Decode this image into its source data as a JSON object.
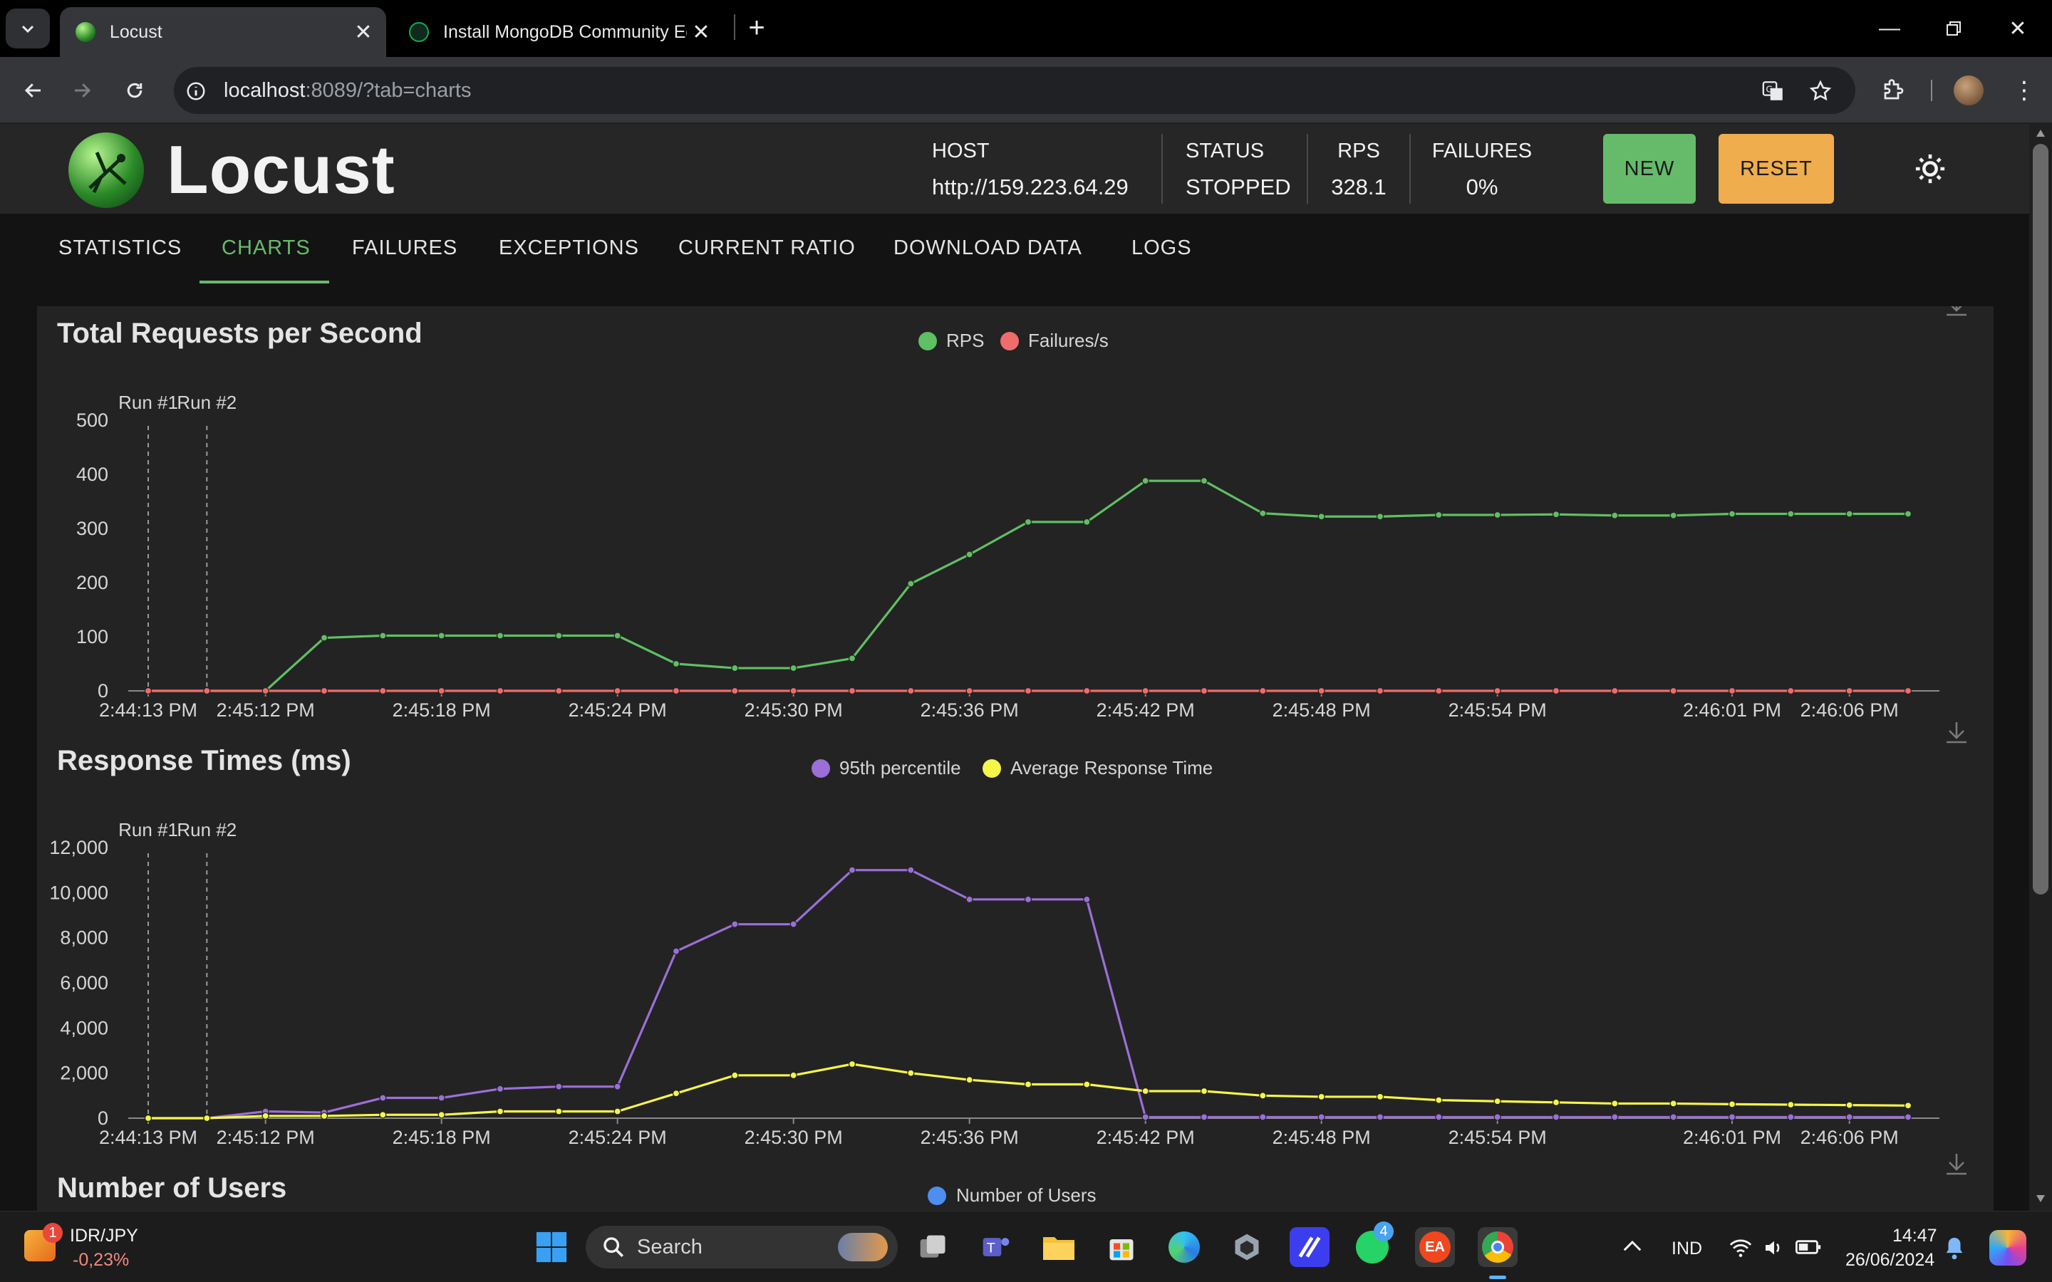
{
  "browser": {
    "tabs": [
      {
        "title": "Locust",
        "active": true
      },
      {
        "title": "Install MongoDB Community Ed",
        "active": false
      }
    ],
    "url_host": "localhost",
    "url_rest": ":8089/?tab=charts",
    "colors": {
      "tabstrip": "#000000",
      "toolbar": "#35363a"
    }
  },
  "app": {
    "brand": "Locust",
    "host_label": "HOST",
    "host_value": "http://159.223.64.29",
    "status_label": "STATUS",
    "status_value": "STOPPED",
    "rps_label": "RPS",
    "rps_value": "328.1",
    "failures_label": "FAILURES",
    "failures_value": "0%",
    "new_label": "NEW",
    "reset_label": "RESET",
    "colors": {
      "new": "#66bb6a",
      "reset": "#f0ad4e",
      "accent": "#66bb6a"
    },
    "tabs": [
      "STATISTICS",
      "CHARTS",
      "FAILURES",
      "EXCEPTIONS",
      "CURRENT RATIO",
      "DOWNLOAD DATA",
      "LOGS"
    ],
    "active_tab": "CHARTS"
  },
  "chart_data": [
    {
      "type": "line",
      "title": "Total Requests per Second",
      "x": [
        "2:44:13 PM",
        "2:45:10 PM",
        "2:45:12 PM",
        "2:45:14 PM",
        "2:45:16 PM",
        "2:45:18 PM",
        "2:45:20 PM",
        "2:45:22 PM",
        "2:45:24 PM",
        "2:45:26 PM",
        "2:45:28 PM",
        "2:45:30 PM",
        "2:45:32 PM",
        "2:45:34 PM",
        "2:45:36 PM",
        "2:45:38 PM",
        "2:45:40 PM",
        "2:45:42 PM",
        "2:45:44 PM",
        "2:45:46 PM",
        "2:45:48 PM",
        "2:45:50 PM",
        "2:45:52 PM",
        "2:45:54 PM",
        "2:45:56 PM",
        "2:45:58 PM",
        "2:46:00 PM",
        "2:46:02 PM",
        "2:46:04 PM",
        "2:46:06 PM",
        "2:46:08 PM"
      ],
      "xticks": [
        "2:44:13 PM",
        "2:45:12 PM",
        "2:45:18 PM",
        "2:45:24 PM",
        "2:45:30 PM",
        "2:45:36 PM",
        "2:45:42 PM",
        "2:45:48 PM",
        "2:45:54 PM",
        "2:46:01 PM",
        "2:46:06 PM"
      ],
      "ylim": [
        0,
        500
      ],
      "yticks": [
        "0",
        "100",
        "200",
        "300",
        "400",
        "500"
      ],
      "run_markers": [
        "Run #1",
        "Run #2"
      ],
      "series": [
        {
          "name": "RPS",
          "color": "#5fbf63",
          "values": [
            0,
            0,
            0,
            98,
            102,
            102,
            102,
            102,
            102,
            50,
            42,
            42,
            60,
            198,
            252,
            312,
            312,
            388,
            388,
            328,
            322,
            322,
            325,
            325,
            326,
            324,
            324,
            327,
            327,
            327,
            327
          ]
        },
        {
          "name": "Failures/s",
          "color": "#ef6c6c",
          "values": [
            0,
            0,
            0,
            0,
            0,
            0,
            0,
            0,
            0,
            0,
            0,
            0,
            0,
            0,
            0,
            0,
            0,
            0,
            0,
            0,
            0,
            0,
            0,
            0,
            0,
            0,
            0,
            0,
            0,
            0,
            0
          ]
        }
      ]
    },
    {
      "type": "line",
      "title": "Response Times (ms)",
      "x": [
        "2:44:13 PM",
        "2:45:10 PM",
        "2:45:12 PM",
        "2:45:14 PM",
        "2:45:16 PM",
        "2:45:18 PM",
        "2:45:20 PM",
        "2:45:22 PM",
        "2:45:24 PM",
        "2:45:26 PM",
        "2:45:28 PM",
        "2:45:30 PM",
        "2:45:32 PM",
        "2:45:34 PM",
        "2:45:36 PM",
        "2:45:38 PM",
        "2:45:40 PM",
        "2:45:42 PM",
        "2:45:44 PM",
        "2:45:46 PM",
        "2:45:48 PM",
        "2:45:50 PM",
        "2:45:52 PM",
        "2:45:54 PM",
        "2:45:56 PM",
        "2:45:58 PM",
        "2:46:00 PM",
        "2:46:02 PM",
        "2:46:04 PM",
        "2:46:06 PM",
        "2:46:08 PM"
      ],
      "xticks": [
        "2:44:13 PM",
        "2:45:12 PM",
        "2:45:18 PM",
        "2:45:24 PM",
        "2:45:30 PM",
        "2:45:36 PM",
        "2:45:42 PM",
        "2:45:48 PM",
        "2:45:54 PM",
        "2:46:01 PM",
        "2:46:06 PM"
      ],
      "ylim": [
        0,
        12000
      ],
      "yticks": [
        "0",
        "2,000",
        "4,000",
        "6,000",
        "8,000",
        "10,000",
        "12,000"
      ],
      "run_markers": [
        "Run #1",
        "Run #2"
      ],
      "series": [
        {
          "name": "95th percentile",
          "color": "#9b6fd6",
          "values": [
            0,
            0,
            300,
            250,
            900,
            900,
            1300,
            1400,
            1400,
            7400,
            8600,
            8600,
            11000,
            11000,
            9700,
            9700,
            9700,
            50,
            50,
            50,
            50,
            50,
            50,
            50,
            50,
            50,
            50,
            50,
            50,
            50,
            50
          ]
        },
        {
          "name": "Average Response Time",
          "color": "#f5f54a",
          "values": [
            0,
            0,
            100,
            100,
            150,
            150,
            300,
            300,
            300,
            1100,
            1900,
            1900,
            2400,
            2000,
            1700,
            1500,
            1500,
            1200,
            1200,
            1000,
            950,
            950,
            800,
            750,
            700,
            650,
            650,
            620,
            600,
            580,
            560
          ]
        }
      ]
    },
    {
      "type": "line",
      "title": "Number of Users",
      "series": [
        {
          "name": "Number of Users",
          "color": "#4d8ef0",
          "values": []
        }
      ]
    }
  ],
  "taskbar": {
    "ticker_name": "IDR/JPY",
    "ticker_change": "-0,23%",
    "ticker_badge": "1",
    "search_label": "Search",
    "whatsapp_badge": "4",
    "lang": "IND",
    "time": "14:47",
    "date": "26/06/2024"
  }
}
